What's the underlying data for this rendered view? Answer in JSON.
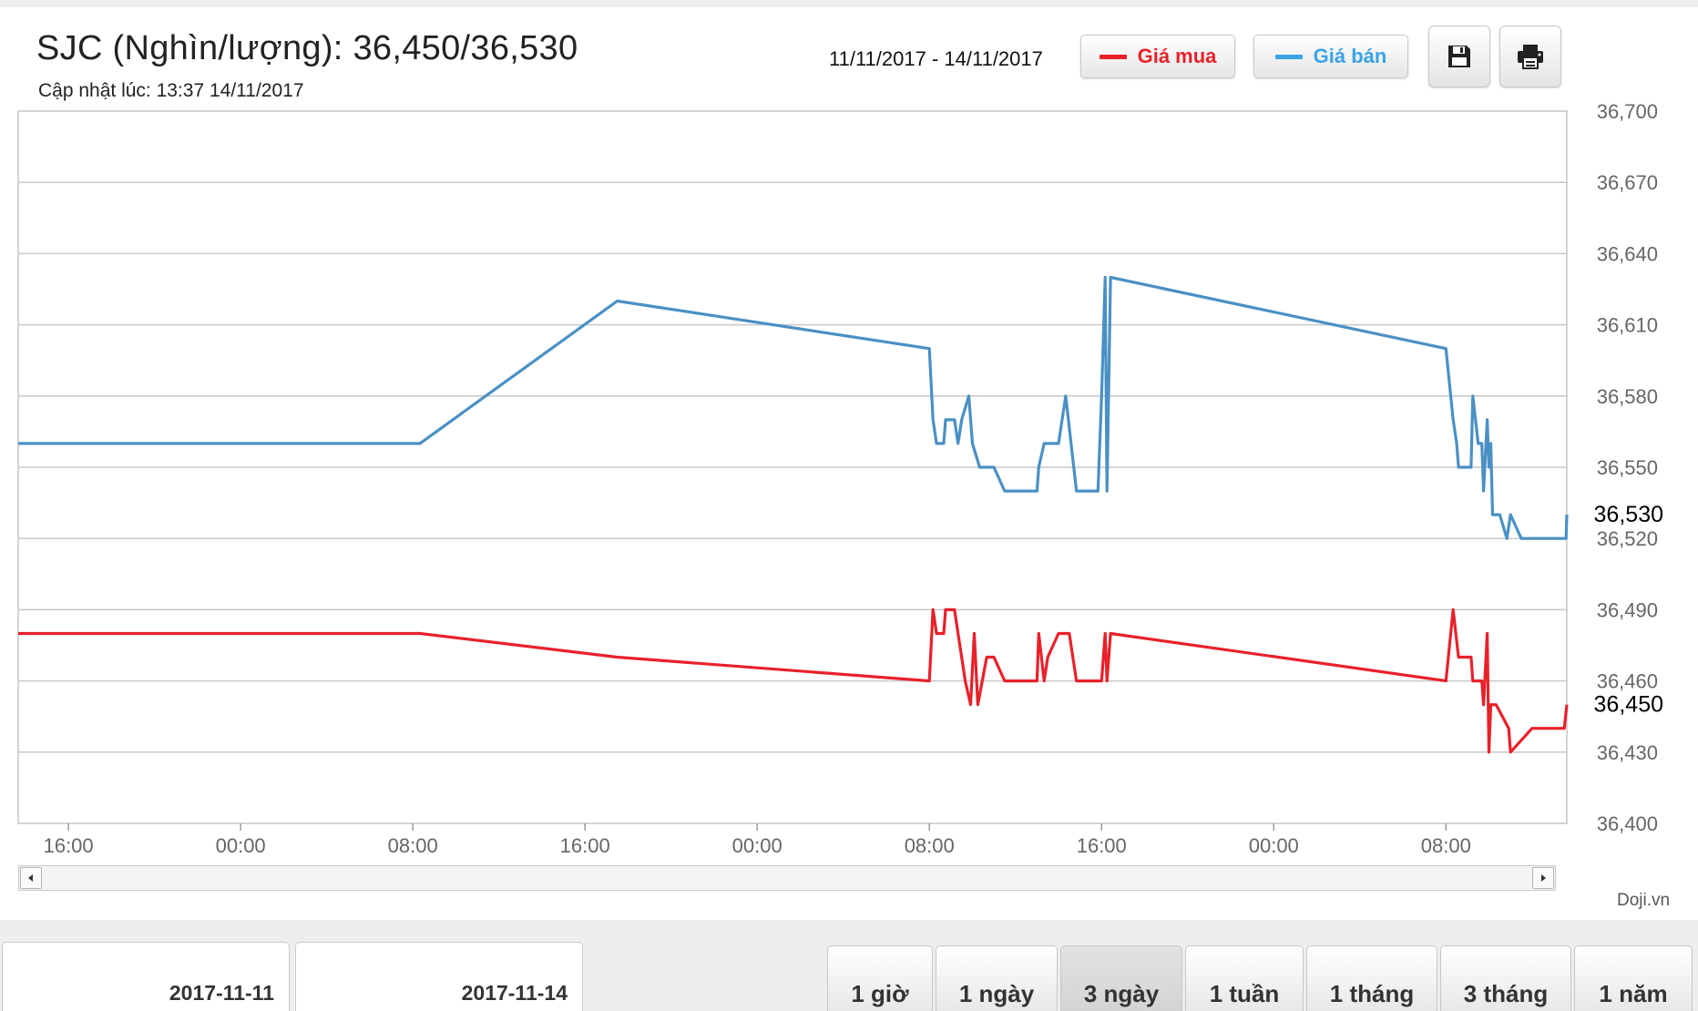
{
  "header": {
    "title": "SJC (Nghìn/lượng): 36,450/36,530",
    "update_label": "Cập nhật lúc: 13:37 14/11/2017",
    "date_range": "11/11/2017 - 14/11/2017"
  },
  "legend": {
    "buy_label": "Giá mua",
    "sell_label": "Giá bán",
    "buy_color": "#e8212a",
    "sell_color": "#39a3e5"
  },
  "toolbar": {
    "save_icon": "floppy-disk-icon",
    "print_icon": "printer-icon"
  },
  "credit": "Doji.vn",
  "date_inputs": {
    "from": "2017-11-11",
    "to": "2017-11-14"
  },
  "range_buttons": [
    {
      "label": "1 giờ",
      "active": false
    },
    {
      "label": "1 ngày",
      "active": false
    },
    {
      "label": "3 ngày",
      "active": true
    },
    {
      "label": "1 tuần",
      "active": false
    },
    {
      "label": "1 tháng",
      "active": false
    },
    {
      "label": "3 tháng",
      "active": false
    },
    {
      "label": "1 năm",
      "active": false
    }
  ],
  "chart_data": {
    "type": "line",
    "xlabel": "",
    "ylabel": "",
    "ylim": [
      36400,
      36700
    ],
    "yticks": [
      36400,
      36430,
      36460,
      36490,
      36520,
      36550,
      36580,
      36610,
      36640,
      36670,
      36700
    ],
    "ytick_labels": [
      "36,400",
      "36,430",
      "36,460",
      "36,490",
      "36,520",
      "36,550",
      "36,580",
      "36,610",
      "36,640",
      "36,670",
      "36,700"
    ],
    "xlim": [
      "2017-11-11 13:40",
      "2017-11-14 13:37"
    ],
    "xticks": [
      "2017-11-11 16:00",
      "2017-11-12 00:00",
      "2017-11-12 08:00",
      "2017-11-12 16:00",
      "2017-11-13 00:00",
      "2017-11-13 08:00",
      "2017-11-13 16:00",
      "2017-11-14 00:00",
      "2017-11-14 08:00"
    ],
    "xtick_labels": [
      "16:00",
      "00:00",
      "08:00",
      "16:00",
      "00:00",
      "08:00",
      "16:00",
      "00:00",
      "08:00"
    ],
    "grid": true,
    "legend_position": "top-right",
    "last_values": [
      {
        "series": "Giá bán",
        "value": "36,530"
      },
      {
        "series": "Giá mua",
        "value": "36,450"
      }
    ],
    "series": [
      {
        "name": "Giá bán",
        "color": "#4a90c4",
        "points": [
          [
            "2017-11-11 13:40",
            36560
          ],
          [
            "2017-11-12 08:20",
            36560
          ],
          [
            "2017-11-12 17:30",
            36620
          ],
          [
            "2017-11-13 08:00",
            36600
          ],
          [
            "2017-11-13 08:10",
            36570
          ],
          [
            "2017-11-13 08:20",
            36560
          ],
          [
            "2017-11-13 08:40",
            36560
          ],
          [
            "2017-11-13 08:45",
            36570
          ],
          [
            "2017-11-13 09:10",
            36570
          ],
          [
            "2017-11-13 09:20",
            36560
          ],
          [
            "2017-11-13 09:30",
            36570
          ],
          [
            "2017-11-13 09:50",
            36580
          ],
          [
            "2017-11-13 10:00",
            36560
          ],
          [
            "2017-11-13 10:20",
            36550
          ],
          [
            "2017-11-13 11:00",
            36550
          ],
          [
            "2017-11-13 11:30",
            36540
          ],
          [
            "2017-11-13 13:00",
            36540
          ],
          [
            "2017-11-13 13:05",
            36550
          ],
          [
            "2017-11-13 13:20",
            36560
          ],
          [
            "2017-11-13 14:00",
            36560
          ],
          [
            "2017-11-13 14:20",
            36580
          ],
          [
            "2017-11-13 14:50",
            36540
          ],
          [
            "2017-11-13 15:50",
            36540
          ],
          [
            "2017-11-13 16:00",
            36580
          ],
          [
            "2017-11-13 16:10",
            36630
          ],
          [
            "2017-11-13 16:15",
            36540
          ],
          [
            "2017-11-13 16:25",
            36630
          ],
          [
            "2017-11-14 08:00",
            36600
          ],
          [
            "2017-11-14 08:20",
            36570
          ],
          [
            "2017-11-14 08:30",
            36560
          ],
          [
            "2017-11-14 08:35",
            36550
          ],
          [
            "2017-11-14 09:10",
            36550
          ],
          [
            "2017-11-14 09:15",
            36580
          ],
          [
            "2017-11-14 09:30",
            36560
          ],
          [
            "2017-11-14 09:40",
            36560
          ],
          [
            "2017-11-14 09:45",
            36540
          ],
          [
            "2017-11-14 09:55",
            36570
          ],
          [
            "2017-11-14 10:00",
            36550
          ],
          [
            "2017-11-14 10:05",
            36560
          ],
          [
            "2017-11-14 10:10",
            36530
          ],
          [
            "2017-11-14 10:30",
            36530
          ],
          [
            "2017-11-14 10:50",
            36520
          ],
          [
            "2017-11-14 11:00",
            36530
          ],
          [
            "2017-11-14 11:30",
            36520
          ],
          [
            "2017-11-14 13:35",
            36520
          ],
          [
            "2017-11-14 13:37",
            36530
          ]
        ]
      },
      {
        "name": "Giá mua",
        "color": "#e8212a",
        "points": [
          [
            "2017-11-11 13:40",
            36480
          ],
          [
            "2017-11-12 08:20",
            36480
          ],
          [
            "2017-11-12 17:30",
            36470
          ],
          [
            "2017-11-13 08:00",
            36460
          ],
          [
            "2017-11-13 08:10",
            36490
          ],
          [
            "2017-11-13 08:20",
            36480
          ],
          [
            "2017-11-13 08:40",
            36480
          ],
          [
            "2017-11-13 08:45",
            36490
          ],
          [
            "2017-11-13 09:10",
            36490
          ],
          [
            "2017-11-13 09:40",
            36460
          ],
          [
            "2017-11-13 09:55",
            36450
          ],
          [
            "2017-11-13 10:05",
            36480
          ],
          [
            "2017-11-13 10:15",
            36450
          ],
          [
            "2017-11-13 10:40",
            36470
          ],
          [
            "2017-11-13 11:00",
            36470
          ],
          [
            "2017-11-13 11:30",
            36460
          ],
          [
            "2017-11-13 13:00",
            36460
          ],
          [
            "2017-11-13 13:05",
            36480
          ],
          [
            "2017-11-13 13:20",
            36460
          ],
          [
            "2017-11-13 13:30",
            36470
          ],
          [
            "2017-11-13 14:00",
            36480
          ],
          [
            "2017-11-13 14:30",
            36480
          ],
          [
            "2017-11-13 14:50",
            36460
          ],
          [
            "2017-11-13 16:00",
            36460
          ],
          [
            "2017-11-13 16:10",
            36480
          ],
          [
            "2017-11-13 16:15",
            36460
          ],
          [
            "2017-11-13 16:25",
            36480
          ],
          [
            "2017-11-14 08:00",
            36460
          ],
          [
            "2017-11-14 08:20",
            36490
          ],
          [
            "2017-11-14 08:35",
            36470
          ],
          [
            "2017-11-14 09:10",
            36470
          ],
          [
            "2017-11-14 09:15",
            36460
          ],
          [
            "2017-11-14 09:40",
            36460
          ],
          [
            "2017-11-14 09:45",
            36450
          ],
          [
            "2017-11-14 09:55",
            36480
          ],
          [
            "2017-11-14 10:00",
            36430
          ],
          [
            "2017-11-14 10:05",
            36450
          ],
          [
            "2017-11-14 10:20",
            36450
          ],
          [
            "2017-11-14 10:55",
            36440
          ],
          [
            "2017-11-14 11:00",
            36430
          ],
          [
            "2017-11-14 12:00",
            36440
          ],
          [
            "2017-11-14 13:30",
            36440
          ],
          [
            "2017-11-14 13:37",
            36450
          ]
        ]
      }
    ]
  }
}
